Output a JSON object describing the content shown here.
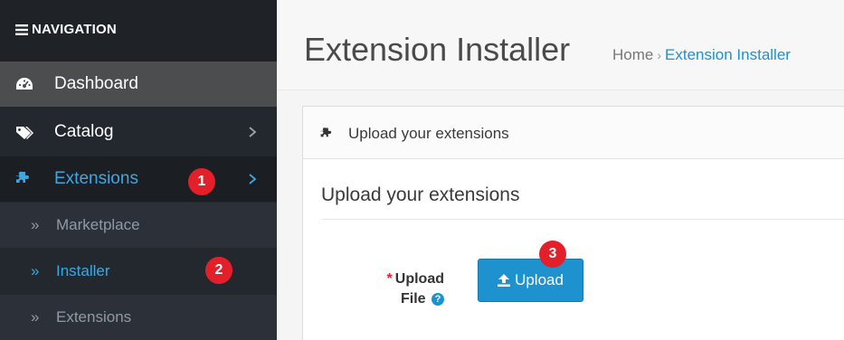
{
  "nav": {
    "header": "NAVIGATION",
    "items": [
      {
        "label": "Dashboard",
        "icon": "dashboard-icon"
      },
      {
        "label": "Catalog",
        "icon": "tags-icon"
      },
      {
        "label": "Extensions",
        "icon": "puzzle-icon"
      }
    ],
    "sub_items": [
      {
        "label": "Marketplace"
      },
      {
        "label": "Installer"
      },
      {
        "label": "Extensions"
      }
    ],
    "sub_prefix": "»"
  },
  "page": {
    "title": "Extension Installer",
    "breadcrumb": {
      "home": "Home",
      "separator": "›",
      "current": "Extension Installer"
    }
  },
  "panel": {
    "heading": "Upload your extensions",
    "legend": "Upload your extensions",
    "field_label_line1": "Upload",
    "field_label_line2": "File",
    "required_mark": "*",
    "help_glyph": "?",
    "upload_button": "Upload"
  },
  "badges": [
    "1",
    "2",
    "3"
  ],
  "colors": {
    "sidebar_bg": "#23282e",
    "active_link": "#3fa7e0",
    "primary_button": "#1e91cf",
    "badge_red": "#e3202a"
  }
}
